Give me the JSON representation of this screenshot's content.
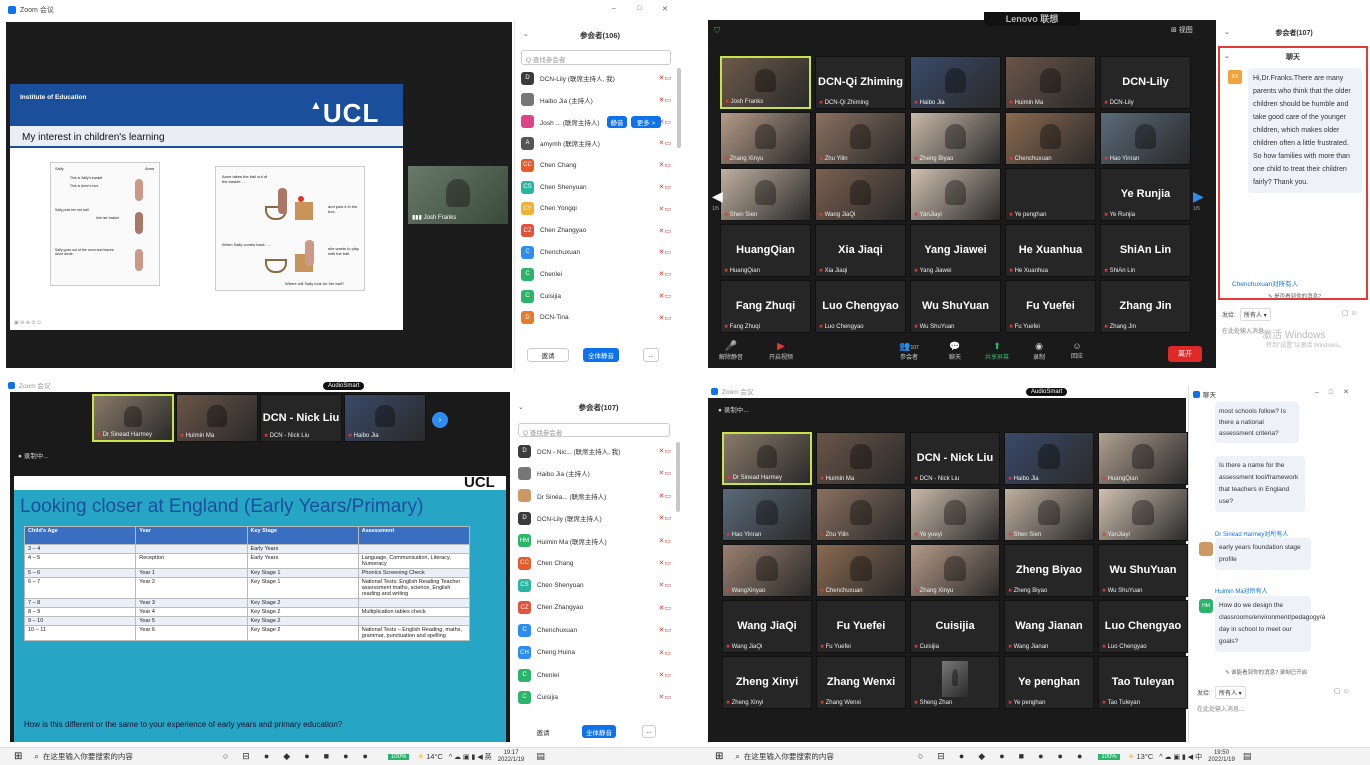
{
  "q1": {
    "window_title": "Zoom 会议",
    "window_controls": [
      "–",
      "□",
      "✕"
    ],
    "slide": {
      "institute": "Institute of Education",
      "logo": "UCL",
      "heading": "My interest in children's learning",
      "captions": {
        "anne_takes": "Anne takes the ball out of the basket . . .",
        "puts_box": "and puts it in the box.",
        "sally_back": "When Sally comes back . . .",
        "she_wants": "she wants to play with the ball.",
        "where": "Where will Sally look for her ball?",
        "sally": "Sally",
        "anne": "Anne",
        "s1": "This is Sally's basket",
        "s2": "This is Anne's box",
        "s3": "Sally puts her red ball",
        "s4": "into her basket",
        "s5": "Sally goes out of the room and leaves Anne alone."
      }
    },
    "presenter_name": "Josh Franks",
    "panel": {
      "title": "参会者(106)",
      "search_placeholder": "Q 查找参会者",
      "participants": [
        {
          "initial": "D",
          "color": "#3b3b3b",
          "name": "DCN-Lily (联席主持人, 我)"
        },
        {
          "initial": "",
          "color": "#777",
          "name": "Haibo Jia (主持人)"
        },
        {
          "initial": "",
          "color": "#d48",
          "name": "Josh ... (联席主持人)"
        },
        {
          "initial": "A",
          "color": "#555",
          "name": "amymh (联席主持人)"
        },
        {
          "initial": "CC",
          "color": "#e55b2b",
          "name": "Chen Chang"
        },
        {
          "initial": "CS",
          "color": "#2bb5a0",
          "name": "Chen Shenyuan"
        },
        {
          "initial": "CY",
          "color": "#f2b134",
          "name": "Chen Yongqi"
        },
        {
          "initial": "CZ",
          "color": "#e0533c",
          "name": "Chen Zhangyao"
        },
        {
          "initial": "C",
          "color": "#2d8cf0",
          "name": "Chenchuxuan"
        },
        {
          "initial": "C",
          "color": "#2bb56a",
          "name": "Chenlei"
        },
        {
          "initial": "C",
          "color": "#2bb56a",
          "name": "Cuisijia"
        },
        {
          "initial": "D",
          "color": "#e57b2b",
          "name": "DCN-Tina"
        }
      ],
      "mute_label": "静音",
      "more_label": "更多 >",
      "invite": "邀请",
      "mute_all": "全体静音",
      "more": "..."
    },
    "slide_footer": "▣ ⊖ ⊕ ⊙ ⊙"
  },
  "q2": {
    "top_brand": "Lenovo 联想",
    "view_label": "⊞ 视图",
    "page_left": "1/5",
    "page_right": "1/5",
    "tiles": [
      {
        "name": "Josh Franks",
        "big": "",
        "video": "#6d5a4a",
        "active": true
      },
      {
        "name": "DCN-Qi Zhiming",
        "big": "DCN-Qi Zhiming"
      },
      {
        "name": "Haibo Jia",
        "big": "",
        "video": "#3a4a6a"
      },
      {
        "name": "Huimin Ma",
        "big": "",
        "video": "#6a5548"
      },
      {
        "name": "DCN-Lily",
        "big": "DCN-Lily"
      },
      {
        "name": "Zhang Xinyu",
        "big": "",
        "video": "#b59a88"
      },
      {
        "name": "Zhu Yilin",
        "big": "",
        "video": "#8a7060"
      },
      {
        "name": "Zheng Biyao",
        "big": "",
        "video": "#c8b8a8"
      },
      {
        "name": "Chenchuxuan",
        "big": "",
        "video": "#8a6a50"
      },
      {
        "name": "Hao Yinran",
        "big": "",
        "video": "#5a6a7a"
      },
      {
        "name": "Shen Sien",
        "big": "",
        "video": "#c0b0a0"
      },
      {
        "name": "Wang JiaQi",
        "big": "",
        "video": "#7a6050"
      },
      {
        "name": "YanJiayi",
        "big": "",
        "video": "#d0c0b0"
      },
      {
        "name": "Ye penghan",
        "big": ""
      },
      {
        "name": "Ye Runjia",
        "big": "Ye Runjia"
      },
      {
        "name": "HuangQian",
        "big": "HuangQian"
      },
      {
        "name": "Xia Jiaqi",
        "big": "Xia Jiaqi"
      },
      {
        "name": "Yang Jiawei",
        "big": "Yang Jiawei"
      },
      {
        "name": "He Xuanhua",
        "big": "He Xuanhua"
      },
      {
        "name": "ShiAn Lin",
        "big": "ShiAn Lin"
      },
      {
        "name": "Fang Zhuqi",
        "big": "Fang Zhuqi"
      },
      {
        "name": "Luo Chengyao",
        "big": "Luo Chengyao"
      },
      {
        "name": "Wu ShuYuan",
        "big": "Wu ShuYuan"
      },
      {
        "name": "Fu Yuefei",
        "big": "Fu Yuefei"
      },
      {
        "name": "Zhang Jin",
        "big": "Zhang Jin"
      }
    ],
    "toolbar": {
      "unmute": "解除静音",
      "video": "开启视频",
      "participants": "参会者",
      "participants_count": "107",
      "chat": "聊天",
      "share": "共享屏幕",
      "record": "录制",
      "react": "回应",
      "leave": "离开"
    },
    "panel": {
      "title": "参会者(107)",
      "chat_title": "聊天",
      "sender_avatar": "XX",
      "message": "Hi,Dr.Franks.There are many parents who think that the older children should be humble and take good care of the younger children, which makes older children often a little frustrated. So how families with more than one child to treat their children fairly? Thank you.",
      "next_sender": "Chenchuxuan对所有人",
      "unread": "✎ 是否看到你的消息?",
      "to_label": "发给:",
      "to_value": "所有人 ▾",
      "input_placeholder": "在此处输入消息...",
      "windows_watermark": "激活 Windows",
      "windows_sub": "转到\"设置\"以激活 Windows。"
    }
  },
  "q3": {
    "window_title": "Zoom 会议",
    "audio_badge": "AudioSmart",
    "recording": "● 录制中...",
    "top_tiles": [
      {
        "name": "Dr Sinead Harmey",
        "video": "#8a7a6a",
        "active": true
      },
      {
        "name": "Huimin Ma",
        "video": "#6a5548"
      },
      {
        "name": "DCN - Nick Liu",
        "big": "DCN - Nick Liu"
      },
      {
        "name": "Haibo Jia",
        "video": "#3a4a6a"
      }
    ],
    "slide": {
      "logo": "UCL",
      "heading": "Looking closer at England (Early Years/Primary)",
      "headers": [
        "Child's Age",
        "Year",
        "Key Stage",
        "Assessment"
      ],
      "rows": [
        [
          "3 – 4",
          "",
          "Early Years",
          ""
        ],
        [
          "4 – 5",
          "Reception",
          "Early Years",
          "Language, Communication, Literacy, Numeracy"
        ],
        [
          "5 – 6",
          "Year 1",
          "Key Stage 1",
          "Phonics Screening Check"
        ],
        [
          "6 – 7",
          "Year 2",
          "Key Stage 1",
          "National Tests: English Reading Teacher assessment maths, science, English reading and writing"
        ],
        [
          "7 – 8",
          "Year 3",
          "Key Stage 2",
          ""
        ],
        [
          "8 – 9",
          "Year 4",
          "Key Stage 2",
          "Multiplication tables check"
        ],
        [
          "9 – 10",
          "Year 5",
          "Key Stage 2",
          ""
        ],
        [
          "10 – 11",
          "Year 6",
          "Key Stage 2",
          "National Tests – English Reading, maths, grammar, punctuation and spelling"
        ]
      ],
      "question": "How is this different or the same to your experience of early years and primary education?"
    },
    "panel": {
      "title": "参会者(107)",
      "search_placeholder": "Q 查找参会者",
      "participants": [
        {
          "initial": "D",
          "color": "#3b3b3b",
          "name": "DCN - Nic... (联席主持人, 我)"
        },
        {
          "initial": "",
          "color": "#777",
          "name": "Haibo Jia (主持人)"
        },
        {
          "initial": "",
          "color": "#c96",
          "name": "Dr Sinéa... (联席主持人)"
        },
        {
          "initial": "D",
          "color": "#3b3b3b",
          "name": "DCN-Lily (联席主持人)"
        },
        {
          "initial": "HM",
          "color": "#2bb56a",
          "name": "Huimin Ma (联席主持人)"
        },
        {
          "initial": "CC",
          "color": "#e55b2b",
          "name": "Chen Chang"
        },
        {
          "initial": "CS",
          "color": "#2bb5a0",
          "name": "Chen Shenyuan"
        },
        {
          "initial": "CZ",
          "color": "#e0533c",
          "name": "Chen Zhangyao"
        },
        {
          "initial": "C",
          "color": "#2d8cf0",
          "name": "Chenchuxuan"
        },
        {
          "initial": "CH",
          "color": "#2d8cf0",
          "name": "Cheng Huina"
        },
        {
          "initial": "C",
          "color": "#2bb56a",
          "name": "Chenlei"
        },
        {
          "initial": "C",
          "color": "#2bb56a",
          "name": "Cuisijia"
        }
      ],
      "invite": "邀请",
      "mute_all": "全体静音",
      "more": "..."
    },
    "taskbar": {
      "search": "在这里输入你要搜索的内容",
      "zoom_level": "100%",
      "temp": "14°C",
      "time": "19:17",
      "date": "2022/1/19"
    }
  },
  "q4": {
    "window_title": "Zoom 会议",
    "audio_badge": "AudioSmart",
    "recording": "● 录制中...",
    "tiles": [
      {
        "name": "Dr Sinead Harmey",
        "big": "",
        "video": "#8a7a6a",
        "active": true
      },
      {
        "name": "Huimin Ma",
        "big": "",
        "video": "#6a5548"
      },
      {
        "name": "DCN - Nick Liu",
        "big": "DCN - Nick Liu"
      },
      {
        "name": "Haibo Jia",
        "big": "",
        "video": "#3a4a6a"
      },
      {
        "name": "HuangQian",
        "big": "",
        "video": "#b0a090"
      },
      {
        "name": "Hao Yinran",
        "big": "",
        "video": "#5a6a7a"
      },
      {
        "name": "Zhu Yilin",
        "big": "",
        "video": "#8a7060"
      },
      {
        "name": "Ye yueyi",
        "big": "",
        "video": "#c8b8a8"
      },
      {
        "name": "Shen Sien",
        "big": "",
        "video": "#c0b0a0"
      },
      {
        "name": "YanJiayi",
        "big": "",
        "video": "#d0c0b0"
      },
      {
        "name": "WangXinyao",
        "big": "",
        "video": "#9a8070"
      },
      {
        "name": "Chenchuxuan",
        "big": "",
        "video": "#8a6a50"
      },
      {
        "name": "Zhang Xinyu",
        "big": "",
        "video": "#b59a88"
      },
      {
        "name": "Zheng Biyao",
        "big": "Zheng Biyao"
      },
      {
        "name": "Wu ShuYuan",
        "big": "Wu ShuYuan"
      },
      {
        "name": "Wang JiaQi",
        "big": "Wang JiaQi"
      },
      {
        "name": "Fu Yuefei",
        "big": "Fu Yuefei"
      },
      {
        "name": "Cuisijia",
        "big": "Cuisijia"
      },
      {
        "name": "Wang Jianan",
        "big": "Wang Jianan"
      },
      {
        "name": "Luo Chengyao",
        "big": "Luo Chengyao"
      },
      {
        "name": "Zheng Xinyi",
        "big": "Zheng Xinyi"
      },
      {
        "name": "Zhang Wenxi",
        "big": "Zhang Wenxi"
      },
      {
        "name": "Sheng Zhan",
        "big": "",
        "video": "#777",
        "small": true
      },
      {
        "name": "Ye penghan",
        "big": "Ye penghan"
      },
      {
        "name": "Tao Tuleyan",
        "big": "Tao Tuleyan"
      }
    ],
    "chat": {
      "title": "聊天",
      "msg1": "most schools follow? Is there a national assessment criteria?",
      "msg2": "Is there a name for the assessment tool/framework that teachers in England use?",
      "sender3": "Dr Sinead Harmey对所有人",
      "msg3": "early years foundation stage profile",
      "sender4": "Huimin Ma对所有人",
      "avatar4": "HM",
      "msg4": "How do we design the classrooms/environment/pedagogy/a day in school to meet our goals?",
      "unread": "✎ 谁能看到你的消息? 录制已开启",
      "to_label": "发给:",
      "to_value": "所有人 ▾",
      "input_placeholder": "在此处输入消息..."
    },
    "taskbar": {
      "search": "在这里输入你要搜索的内容",
      "zoom_level": "100%",
      "temp": "13°C",
      "time": "19:50",
      "date": "2022/1/19"
    }
  },
  "colors": {
    "zoom_blue": "#0e72ed",
    "ucl_blue": "#1a4f9c",
    "slide_teal": "#26a6c4",
    "speaker_yellow": "#c8e34a",
    "leave_red": "#e02828"
  }
}
